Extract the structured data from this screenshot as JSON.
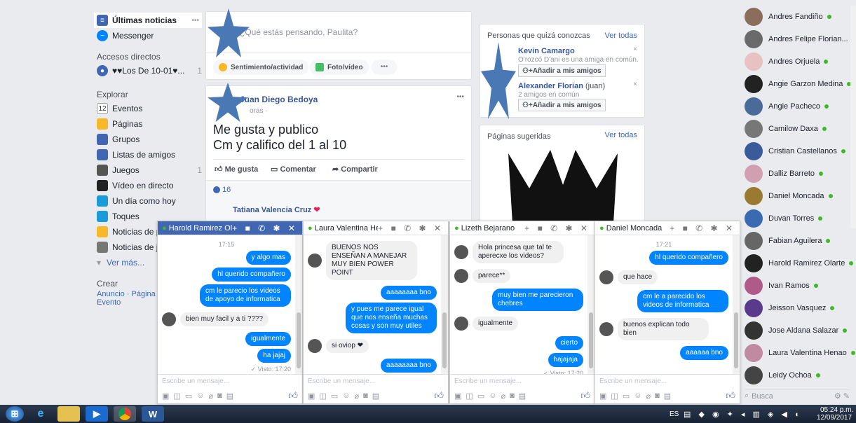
{
  "left_nav": {
    "news": "Últimas noticias",
    "news_more": "•••",
    "messenger": "Messenger",
    "shortcuts_title": "Accesos directos",
    "group_short": "♥♥Los De 10-01♥...",
    "group_count": "1",
    "explore_title": "Explorar",
    "explore": [
      {
        "label": "Eventos",
        "badge": ""
      },
      {
        "label": "Páginas",
        "badge": ""
      },
      {
        "label": "Grupos",
        "badge": ""
      },
      {
        "label": "Listas de amigos",
        "badge": ""
      },
      {
        "label": "Juegos",
        "badge": "1"
      },
      {
        "label": "Vídeo en directo",
        "badge": ""
      },
      {
        "label": "Un día como hoy",
        "badge": ""
      },
      {
        "label": "Toques",
        "badge": ""
      },
      {
        "label": "Noticias de p",
        "badge": ""
      },
      {
        "label": "Noticias de j",
        "badge": ""
      }
    ],
    "more": "Ver más...",
    "create_title": "Crear",
    "create_links": "Anuncio · Página",
    "create_event": "Evento",
    "calendar_num": "12"
  },
  "composer": {
    "placeholder": "¿Qué estás pensando, Paulita?",
    "feeling": "Sentimiento/actividad",
    "photo": "Foto/vídeo",
    "more": "•••"
  },
  "post": {
    "author": "Juan Diego Bedoya",
    "time": "oras · ",
    "text1": "Me gusta y publico",
    "text2": "Cm y califico del 1 al 10",
    "like": "Me gusta",
    "comment": "Comentar",
    "share": "Compartir",
    "reactions": "16",
    "commenter": "Tatiana Valencia Cruz",
    "more": "•••"
  },
  "people": {
    "title": "Personas que quizá conozcas",
    "see_all": "Ver todas",
    "p1_name": "Kevin Camargo",
    "p1_sub": "O'rozcó D'ani es una amiga en común.",
    "p2_name": "Alexander Florian",
    "p2_alias": "(juan)",
    "p2_sub": "2 amigos en común",
    "add": "Añadir a mis amigos",
    "close": "×"
  },
  "pages": {
    "title": "Páginas sugeridas",
    "see_all": "Ver todas"
  },
  "contacts": [
    {
      "name": "Andres Fandiño",
      "color": "#8a6d5a"
    },
    {
      "name": "Andres Felipe Florian...",
      "color": "#6a6a6a"
    },
    {
      "name": "Andres Orjuela",
      "color": "#e8c2c2"
    },
    {
      "name": "Angie Garzon Medina",
      "color": "#222"
    },
    {
      "name": "Angie Pacheco",
      "color": "#4a6a9a"
    },
    {
      "name": "Camilow Daxa",
      "color": "#777"
    },
    {
      "name": "Cristian Castellanos",
      "color": "#3a5a9a"
    },
    {
      "name": "Dalliz Barreto",
      "color": "#d0a0b0"
    },
    {
      "name": "Daniel Moncada",
      "color": "#9a7a30"
    },
    {
      "name": "Duvan Torres",
      "color": "#3a6ab0"
    },
    {
      "name": "Fabian Aguilera",
      "color": "#666"
    },
    {
      "name": "Harold Ramirez Olarte",
      "color": "#222"
    },
    {
      "name": "Ivan Ramos",
      "color": "#b05a8a"
    },
    {
      "name": "Jeisson Vasquez",
      "color": "#5a3a8a"
    },
    {
      "name": "Jose Aldana Salazar",
      "color": "#333"
    },
    {
      "name": "Laura Valentina Henao",
      "color": "#c08aa0"
    },
    {
      "name": "Leidy Ochoa",
      "color": "#444"
    }
  ],
  "search": {
    "placeholder": "Busca"
  },
  "chats": [
    {
      "name": "Harold Ramirez Olarte",
      "controls": "+ ■ ✆ ✱ ✕",
      "time": "17:15",
      "seen": "✓ Visto: 17:20",
      "input": "Escribe un mensaje...",
      "msgs": [
        {
          "who": "me",
          "text": "y algo mas"
        },
        {
          "who": "me",
          "text": "hl querido compañero"
        },
        {
          "who": "me",
          "text": "cm le parecio los videos de apoyo de informatica"
        },
        {
          "who": "them",
          "text": "bien muy facil y a ti ????"
        },
        {
          "who": "me",
          "text": "igualmente"
        },
        {
          "who": "me",
          "text": "ha jajaj"
        }
      ]
    },
    {
      "name": "Laura Valentina Hena",
      "controls": "+ ■ ✆ ✱ ✕",
      "input": "Escribe un mensaje...",
      "msgs": [
        {
          "who": "them",
          "text": "BUENOS NOS ENSEÑAN A MANEJAR MUY BIEN POWER POINT"
        },
        {
          "who": "me",
          "text": "aaaaaaaa bno"
        },
        {
          "who": "me",
          "text": "y pues me parece igual que nos enseña muchas cosas y son muy utiles"
        },
        {
          "who": "them",
          "text": "si oviop ❤"
        },
        {
          "who": "me",
          "text": "aaaaaaaa bno"
        }
      ]
    },
    {
      "name": "Lizeth Bejarano",
      "controls": "+ ■ ✆ ✱ ✕",
      "seen": "✓ Visto: 17:20",
      "input": "Escribe un mensaje...",
      "msgs": [
        {
          "who": "them",
          "text": "Hola princesa que tal te aperecxe los videos?"
        },
        {
          "who": "them",
          "text": "parece**"
        },
        {
          "who": "me",
          "text": "muy bien me parecieron chebres"
        },
        {
          "who": "them",
          "text": "igualmente"
        },
        {
          "who": "me",
          "text": "cierto"
        },
        {
          "who": "me",
          "text": "hajajaja"
        }
      ]
    },
    {
      "name": "Daniel Moncada",
      "controls": "+ ■ ✆ ✱ ✕",
      "time": "17:21",
      "input": "Escribe un mensaje...",
      "msgs": [
        {
          "who": "me",
          "text": "hl querido compañero"
        },
        {
          "who": "them",
          "text": "que hace"
        },
        {
          "who": "me",
          "text": "cm le a parecido los videos de informatica"
        },
        {
          "who": "them",
          "text": "buenos explican todo bien"
        },
        {
          "who": "me",
          "text": "aaaaaa bno"
        }
      ]
    }
  ],
  "taskbar": {
    "lang": "ES",
    "time": "05:24 p.m.",
    "date": "12/09/2017"
  }
}
